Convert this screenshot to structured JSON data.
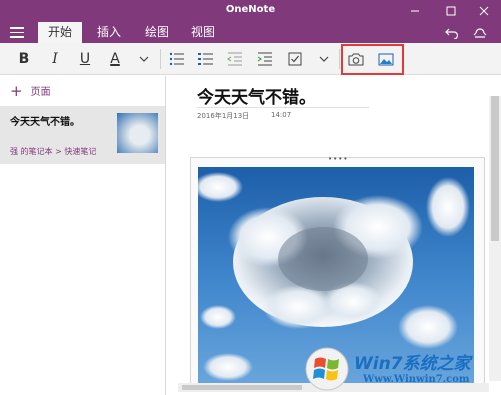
{
  "window": {
    "title": "OneNote"
  },
  "tabs": [
    {
      "label": "开始",
      "active": true
    },
    {
      "label": "插入",
      "active": false
    },
    {
      "label": "绘图",
      "active": false
    },
    {
      "label": "视图",
      "active": false
    }
  ],
  "ribbon": {
    "bold": "B",
    "italic": "I",
    "underline": "U",
    "font_color": "A"
  },
  "sidebar": {
    "add_page": "页面",
    "page": {
      "title": "今天天气不错。",
      "path": "强 的笔记本 > 快速笔记"
    }
  },
  "note": {
    "title": "今天天气不错。",
    "date": "2016年1月13日",
    "time": "14:07"
  },
  "watermark": {
    "brand": "Win7系统之家",
    "url": "Www.Winwin7.com"
  },
  "colors": {
    "accent": "#80397b",
    "highlight": "#e53935",
    "sky": "#2d6fb6"
  }
}
